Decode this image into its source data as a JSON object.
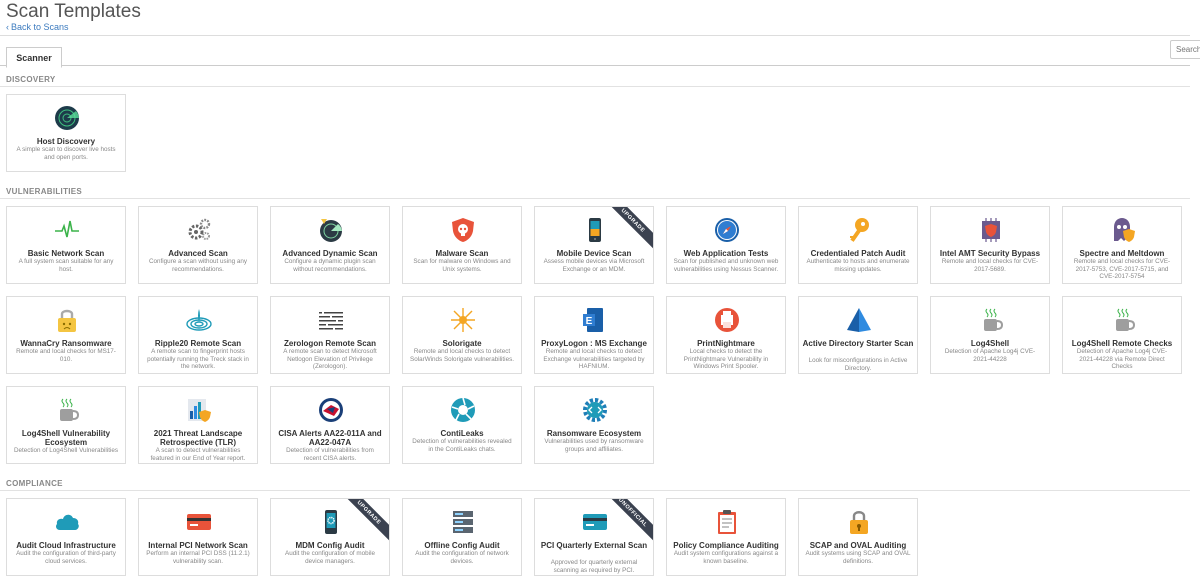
{
  "page": {
    "title": "Scan Templates",
    "back_link": "Back to Scans"
  },
  "tabs": [
    {
      "label": "Scanner"
    }
  ],
  "search": {
    "placeholder": "Search"
  },
  "sections": {
    "discovery": "DISCOVERY",
    "vulnerabilities": "VULNERABILITIES",
    "compliance": "COMPLIANCE"
  },
  "cards": {
    "host_discovery": {
      "name": "Host Discovery",
      "desc": "A simple scan to discover live hosts and open ports.",
      "icon": "radar-icon"
    },
    "basic_network_scan": {
      "name": "Basic Network Scan",
      "desc": "A full system scan suitable for any host.",
      "icon": "heartbeat-icon"
    },
    "advanced_scan": {
      "name": "Advanced Scan",
      "desc": "Configure a scan without using any recommendations.",
      "icon": "gears-icon"
    },
    "advanced_dynamic_scan": {
      "name": "Advanced Dynamic Scan",
      "desc": "Configure a dynamic plugin scan without recommendations.",
      "icon": "dynamic-radar-icon"
    },
    "malware_scan": {
      "name": "Malware Scan",
      "desc": "Scan for malware on Windows and Unix systems.",
      "icon": "skull-shield-icon"
    },
    "mobile_device_scan": {
      "name": "Mobile Device Scan",
      "desc": "Assess mobile devices via Microsoft Exchange or an MDM.",
      "icon": "smartphone-icon",
      "ribbon": "UPGRADE"
    },
    "web_application_tests": {
      "name": "Web Application Tests",
      "desc": "Scan for published and unknown web vulnerabilities using Nessus Scanner.",
      "icon": "compass-icon"
    },
    "credentialed_patch_audit": {
      "name": "Credentialed Patch Audit",
      "desc": "Authenticate to hosts and enumerate missing updates.",
      "icon": "key-icon"
    },
    "intel_amt_security_bypass": {
      "name": "Intel AMT Security Bypass",
      "desc": "Remote and local checks for CVE-2017-5689.",
      "icon": "chip-shield-icon"
    },
    "spectre_meltdown": {
      "name": "Spectre and Meltdown",
      "desc": "Remote and local checks for CVE-2017-5753, CVE-2017-5715, and CVE-2017-5754",
      "icon": "ghost-shield-icon"
    },
    "wannacry": {
      "name": "WannaCry Ransomware",
      "desc": "Remote and local checks for MS17-010.",
      "icon": "padlock-face-icon"
    },
    "ripple20": {
      "name": "Ripple20 Remote Scan",
      "desc": "A remote scan to fingerprint hosts potentially running the Treck stack in the network.",
      "icon": "ripple-icon"
    },
    "zerologon": {
      "name": "Zerologon Remote Scan",
      "desc": "A remote scan to detect Microsoft Netlogon Elevation of Privilege (Zerologon).",
      "icon": "zerologon-icon"
    },
    "solorigate": {
      "name": "Solorigate",
      "desc": "Remote and local checks to detect SolarWinds Solorigate vulnerabilities.",
      "icon": "sunburst-icon"
    },
    "proxylogon": {
      "name": "ProxyLogon : MS Exchange",
      "desc": "Remote and local checks to detect Exchange vulnerabilities targeted by HAFNIUM.",
      "icon": "exchange-icon"
    },
    "printnightmare": {
      "name": "PrintNightmare",
      "desc": "Local checks to detect the PrintNightmare Vulnerability in Windows Print Spooler.",
      "icon": "printnightmare-icon"
    },
    "active_directory_starter": {
      "name": "Active Directory Starter Scan",
      "desc": "Look for misconfigurations in Active Directory.",
      "icon": "pyramid-icon"
    },
    "log4shell": {
      "name": "Log4Shell",
      "desc": "Detection of Apache Log4j CVE-2021-44228",
      "icon": "coffee-mug-icon"
    },
    "log4shell_remote": {
      "name": "Log4Shell Remote Checks",
      "desc": "Detection of Apache Log4j CVE-2021-44228 via Remote Direct Checks",
      "icon": "coffee-mug-icon"
    },
    "log4shell_ecosystem": {
      "name": "Log4Shell Vulnerability Ecosystem",
      "desc": "Detection of Log4Shell Vulnerabilities",
      "icon": "coffee-mug-icon"
    },
    "threat_landscape": {
      "name": "2021 Threat Landscape Retrospective (TLR)",
      "desc": "A scan to detect vulnerabilities featured in our End of Year report.",
      "icon": "chart-shield-icon"
    },
    "cisa_alerts": {
      "name": "CISA Alerts AA22-011A and AA22-047A",
      "desc": "Detection of vulnerabilities from recent CISA alerts.",
      "icon": "cisa-seal-icon"
    },
    "contileaks": {
      "name": "ContiLeaks",
      "desc": "Detection of vulnerabilities revealed in the ContiLeaks chats.",
      "icon": "aperture-icon"
    },
    "ransomware_ecosystem": {
      "name": "Ransomware Ecosystem",
      "desc": "Vulnerabilities used by ransomware groups and affiliates.",
      "icon": "code-gear-icon"
    },
    "audit_cloud": {
      "name": "Audit Cloud Infrastructure",
      "desc": "Audit the configuration of third-party cloud services.",
      "icon": "cloud-icon"
    },
    "internal_pci": {
      "name": "Internal PCI Network Scan",
      "desc": "Perform an internal PCI DSS (11.2.1) vulnerability scan.",
      "icon": "credit-card-icon"
    },
    "mdm_config_audit": {
      "name": "MDM Config Audit",
      "desc": "Audit the configuration of mobile device managers.",
      "icon": "phone-gear-icon",
      "ribbon": "UPGRADE"
    },
    "offline_config_audit": {
      "name": "Offline Config Audit",
      "desc": "Audit the configuration of network devices.",
      "icon": "server-icon"
    },
    "pci_quarterly": {
      "name": "PCI Quarterly External Scan",
      "desc": "Approved for quarterly external scanning as required by PCI.",
      "icon": "credit-card-teal-icon",
      "ribbon": "UNOFFICIAL"
    },
    "policy_compliance": {
      "name": "Policy Compliance Auditing",
      "desc": "Audit system configurations against a known baseline.",
      "icon": "clipboard-icon"
    },
    "scap_oval": {
      "name": "SCAP and OVAL Auditing",
      "desc": "Audit systems using SCAP and OVAL definitions.",
      "icon": "padlock-icon"
    }
  },
  "colors": {
    "link": "#3c7bbf",
    "ribbon": "#3b4250",
    "teal": "#1f9bb8",
    "orange": "#f4a623"
  }
}
